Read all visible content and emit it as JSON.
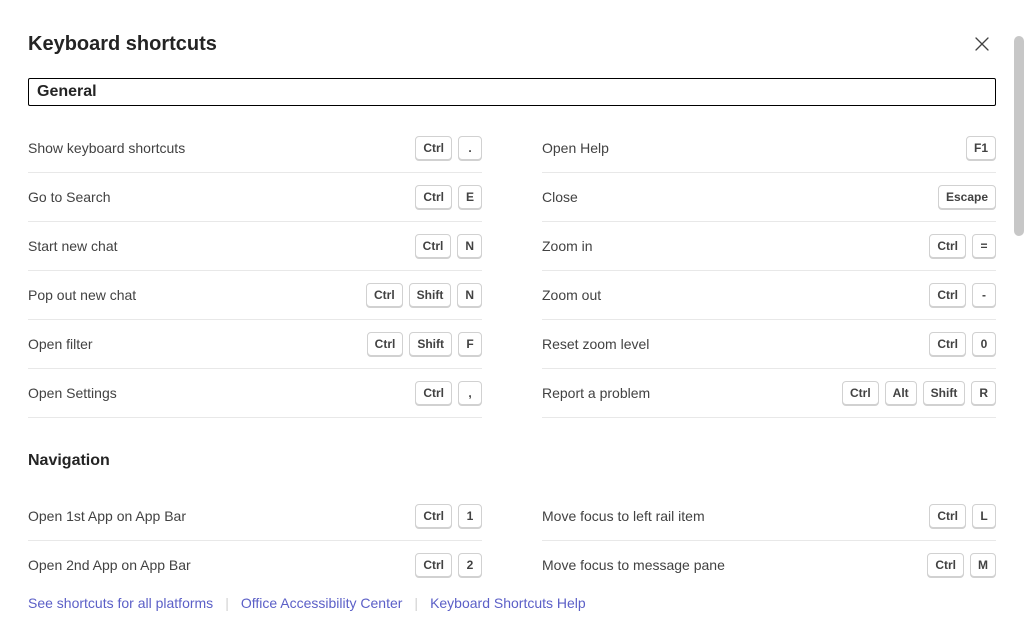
{
  "title": "Keyboard shortcuts",
  "sections": {
    "general": {
      "label": "General"
    },
    "navigation": {
      "label": "Navigation"
    }
  },
  "general_left": [
    {
      "label": "Show keyboard shortcuts",
      "keys": [
        "Ctrl",
        "."
      ]
    },
    {
      "label": "Go to Search",
      "keys": [
        "Ctrl",
        "E"
      ]
    },
    {
      "label": "Start new chat",
      "keys": [
        "Ctrl",
        "N"
      ]
    },
    {
      "label": "Pop out new chat",
      "keys": [
        "Ctrl",
        "Shift",
        "N"
      ]
    },
    {
      "label": "Open filter",
      "keys": [
        "Ctrl",
        "Shift",
        "F"
      ]
    },
    {
      "label": "Open Settings",
      "keys": [
        "Ctrl",
        ","
      ]
    }
  ],
  "general_right": [
    {
      "label": "Open Help",
      "keys": [
        "F1"
      ]
    },
    {
      "label": "Close",
      "keys": [
        "Escape"
      ]
    },
    {
      "label": "Zoom in",
      "keys": [
        "Ctrl",
        "="
      ]
    },
    {
      "label": "Zoom out",
      "keys": [
        "Ctrl",
        "-"
      ]
    },
    {
      "label": "Reset zoom level",
      "keys": [
        "Ctrl",
        "0"
      ]
    },
    {
      "label": "Report a problem",
      "keys": [
        "Ctrl",
        "Alt",
        "Shift",
        "R"
      ]
    }
  ],
  "navigation_left": [
    {
      "label": "Open 1st App on App Bar",
      "keys": [
        "Ctrl",
        "1"
      ]
    },
    {
      "label": "Open 2nd App on App Bar",
      "keys": [
        "Ctrl",
        "2"
      ]
    }
  ],
  "navigation_right": [
    {
      "label": "Move focus to left rail item",
      "keys": [
        "Ctrl",
        "L"
      ]
    },
    {
      "label": "Move focus to message pane",
      "keys": [
        "Ctrl",
        "M"
      ]
    }
  ],
  "footer": {
    "all_platforms": "See shortcuts for all platforms",
    "accessibility": "Office Accessibility Center",
    "help": "Keyboard Shortcuts Help"
  }
}
